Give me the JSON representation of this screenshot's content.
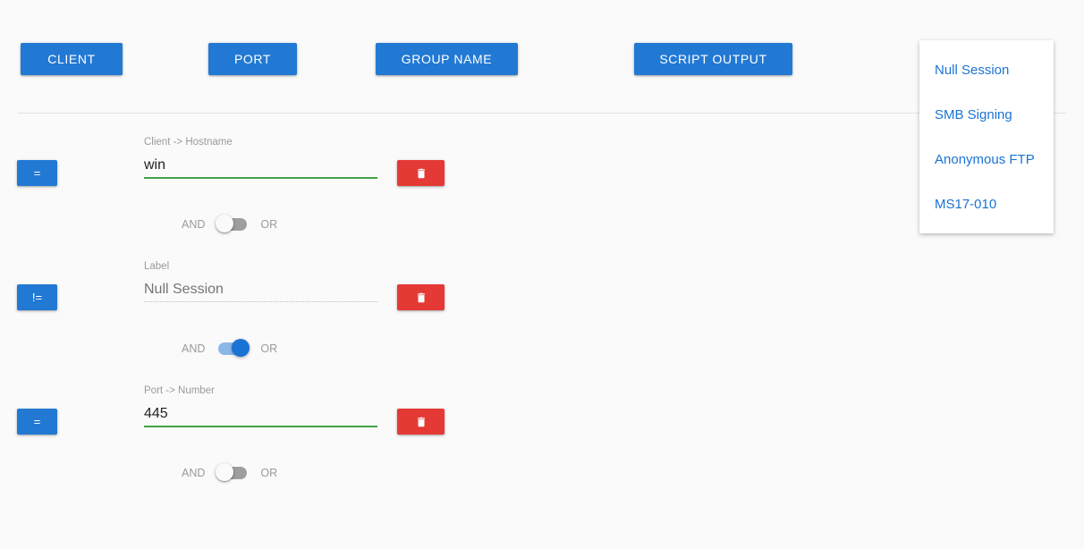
{
  "topbar": {
    "buttons": [
      {
        "label": "CLIENT",
        "name": "category-button-client"
      },
      {
        "label": "PORT",
        "name": "category-button-port"
      },
      {
        "label": "GROUP NAME",
        "name": "category-button-group-name"
      },
      {
        "label": "SCRIPT OUTPUT",
        "name": "category-button-script-output"
      }
    ]
  },
  "colors": {
    "primary_blue": "#2279d4",
    "link_blue": "#1a73d4",
    "danger_red": "#e53935",
    "valid_green": "#43a047",
    "page_background": "#fafafa",
    "label_gray": "#9a9a9a"
  },
  "rules": [
    {
      "operator": "=",
      "field_label": "Client -> Hostname",
      "value": "win",
      "placeholder": "",
      "is_placeholder": false,
      "underline": "solid-green",
      "delete_label": "delete",
      "connector": {
        "and_label": "AND",
        "or_label": "OR",
        "state": "AND"
      }
    },
    {
      "operator": "!=",
      "field_label": "Label",
      "value": "Null Session",
      "placeholder": "Null Session",
      "is_placeholder": true,
      "underline": "dotted-gray",
      "delete_label": "delete",
      "connector": {
        "and_label": "AND",
        "or_label": "OR",
        "state": "OR"
      }
    },
    {
      "operator": "=",
      "field_label": "Port -> Number",
      "value": "445",
      "placeholder": "",
      "is_placeholder": false,
      "underline": "solid-green",
      "delete_label": "delete",
      "connector": {
        "and_label": "AND",
        "or_label": "OR",
        "state": "AND"
      }
    }
  ],
  "dropdown": {
    "items": [
      {
        "label": "Null Session"
      },
      {
        "label": "SMB Signing"
      },
      {
        "label": "Anonymous FTP"
      },
      {
        "label": "MS17-010"
      }
    ]
  }
}
